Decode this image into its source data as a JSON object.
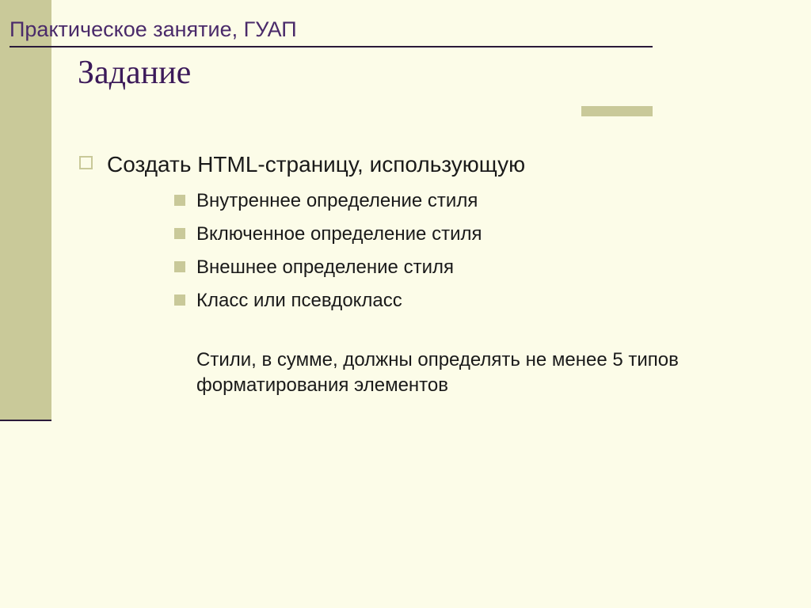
{
  "header": {
    "label": "Практическое занятие, ГУАП"
  },
  "title": "Задание",
  "body": {
    "main_item": "Создать HTML-страницу, использующую",
    "sub_items": [
      "Внутреннее определение стиля",
      "Включенное определение стиля",
      "Внешнее определение стиля",
      "Класс или псевдокласс"
    ],
    "summary": "Стили, в сумме, должны определять не менее 5 типов форматирования элементов"
  }
}
